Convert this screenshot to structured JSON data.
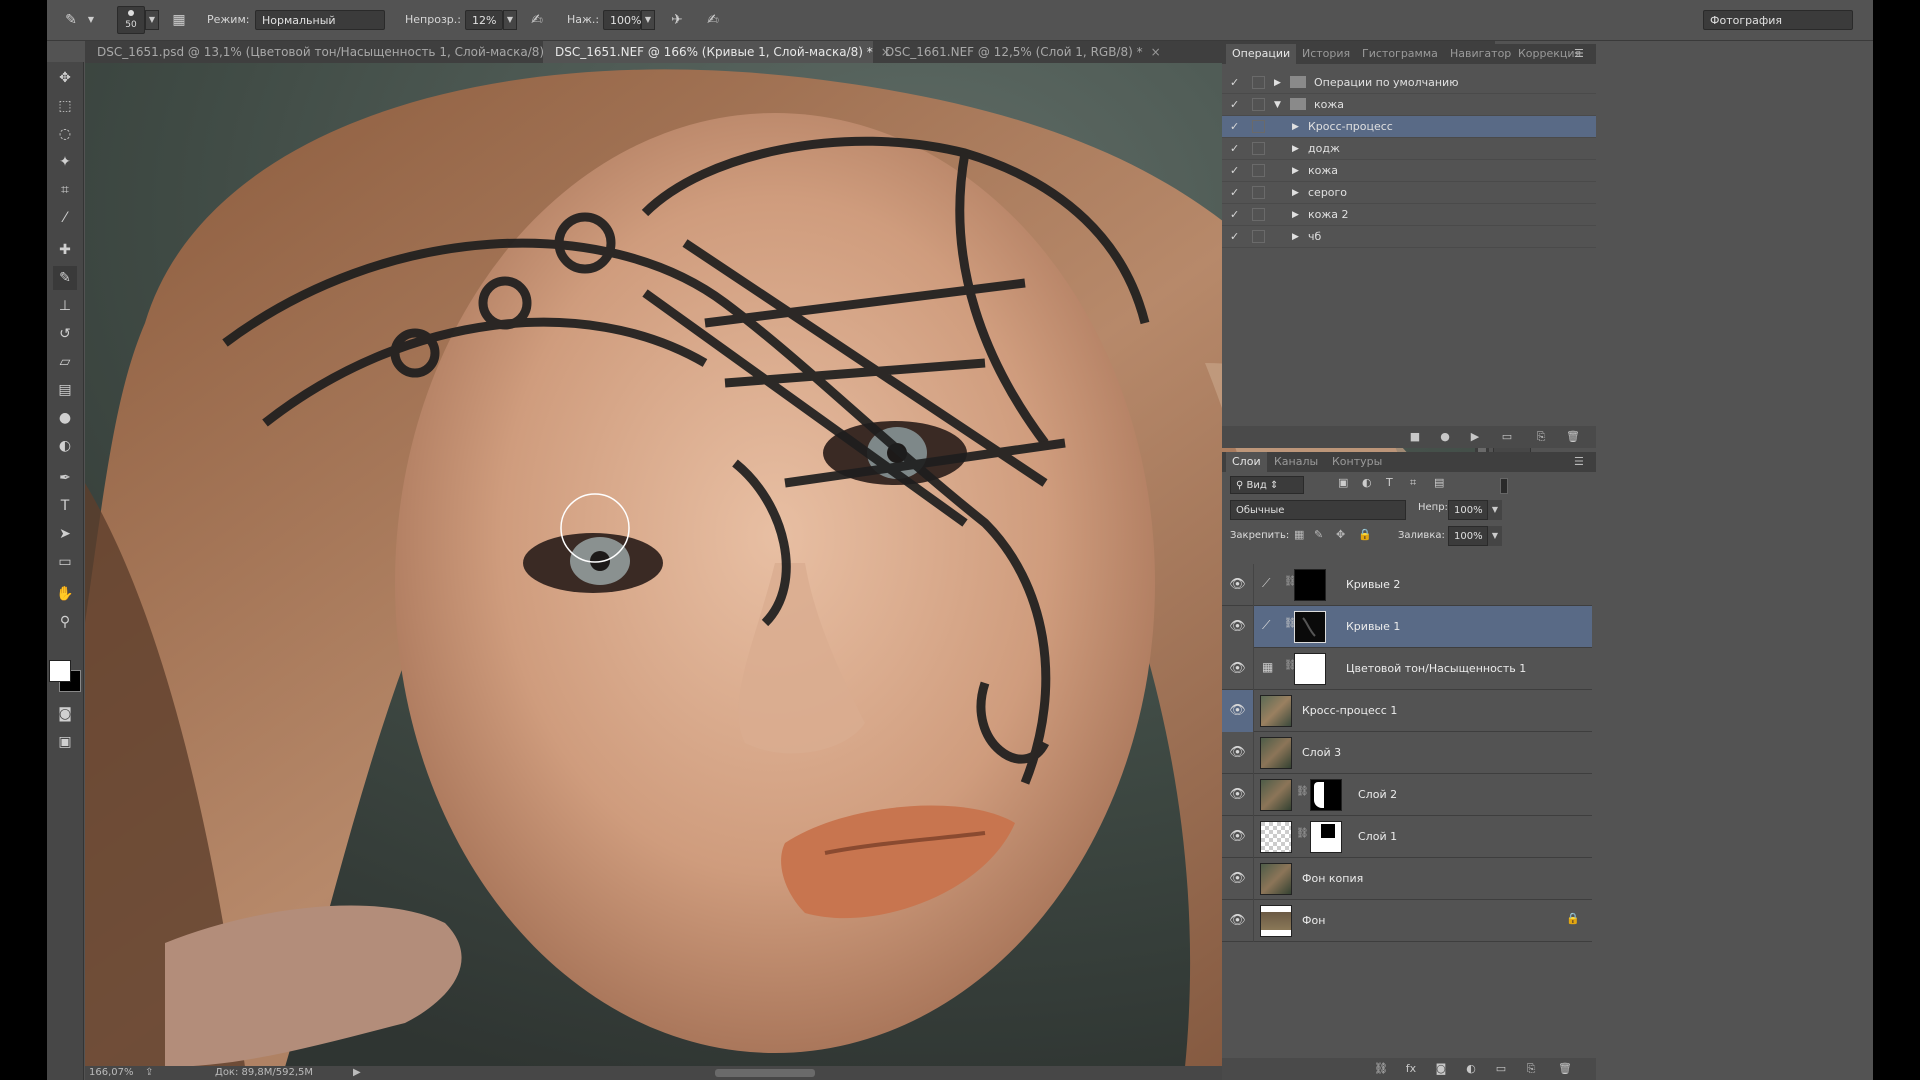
{
  "options_bar": {
    "brush_size": "50",
    "mode_label": "Режим:",
    "mode_value": "Нормальный",
    "opacity_label": "Непрозр.:",
    "opacity_value": "12%",
    "pressure_label": "Наж.:",
    "pressure_value": "100%",
    "workspace_value": "Фотография"
  },
  "tabs": [
    {
      "label": "DSC_1651.psd @ 13,1% (Цветовой тон/Насыщенность 1, Слой-маска/8) *",
      "close": "×"
    },
    {
      "label": "DSC_1651.NEF @ 166% (Кривые 1, Слой-маска/8) *",
      "close": "×"
    },
    {
      "label": "DSC_1661.NEF @ 12,5% (Слой 1, RGB/8) *",
      "close": "×"
    }
  ],
  "status_bar": {
    "zoom": "166,07%",
    "doc_size": "Док: 89,8M/592,5M"
  },
  "actions_panel": {
    "tabs": [
      "Операции",
      "История",
      "Гистограмма",
      "Навигатор",
      "Коррекция"
    ],
    "rows": [
      {
        "label": "Операции по умолчанию",
        "check": "✓"
      },
      {
        "label": "кожа",
        "check": "✓"
      },
      {
        "label": "Кросс-процесс",
        "check": "✓"
      },
      {
        "label": "додж",
        "check": "✓"
      },
      {
        "label": "кожа",
        "check": "✓"
      },
      {
        "label": "серого",
        "check": "✓"
      },
      {
        "label": "кожа 2",
        "check": "✓"
      },
      {
        "label": "чб",
        "check": "✓"
      }
    ]
  },
  "layers_panel": {
    "tabs": [
      "Слои",
      "Каналы",
      "Контуры"
    ],
    "filter_label": "Вид",
    "blend_mode": "Обычные",
    "opacity_label": "Непр:",
    "opacity_value": "100%",
    "lock_label": "Закрепить:",
    "fill_label": "Заливка:",
    "fill_value": "100%",
    "layers": [
      {
        "name": "Кривые 2"
      },
      {
        "name": "Кривые 1"
      },
      {
        "name": "Цветовой тон/Насыщенность 1"
      },
      {
        "name": "Кросс-процесс 1"
      },
      {
        "name": "Слой 3"
      },
      {
        "name": "Слой 2"
      },
      {
        "name": "Слой 1"
      },
      {
        "name": "Фон копия"
      },
      {
        "name": "Фон"
      }
    ]
  },
  "colors": {
    "selection": "#596a86",
    "panel_bg": "#535353",
    "dark_bg": "#3f3f3f"
  }
}
